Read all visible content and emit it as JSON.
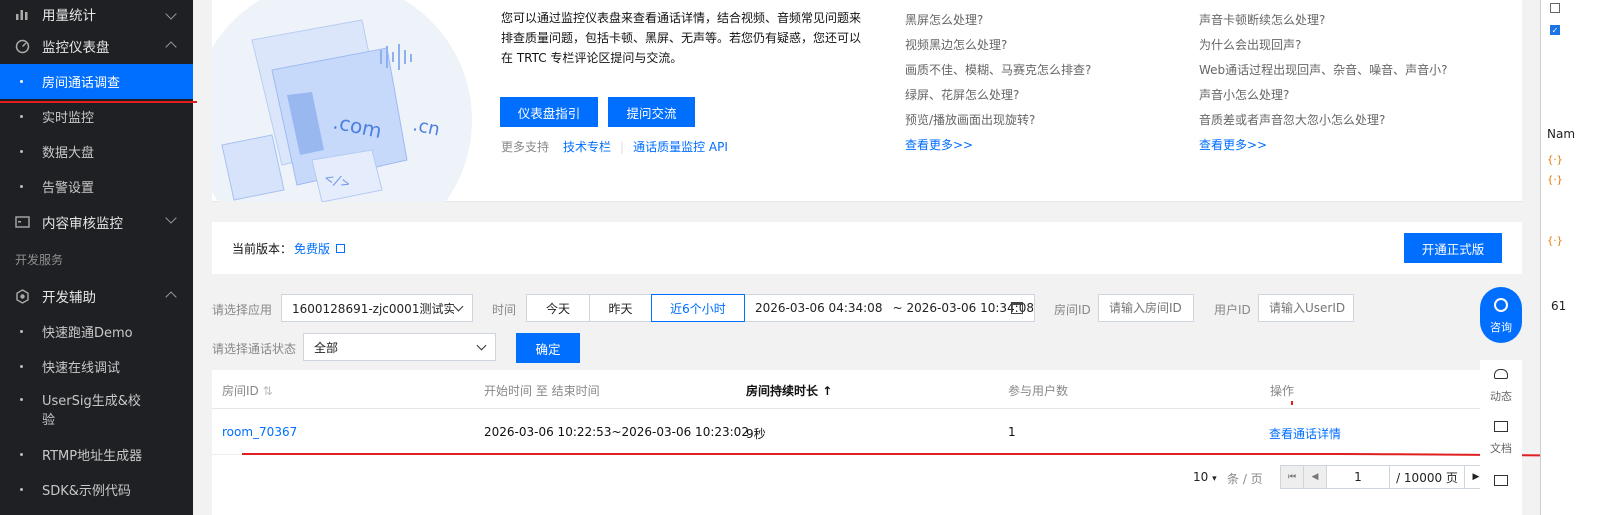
{
  "sidebar": {
    "groups": [
      {
        "label": "用量统计",
        "icon": "bar-chart-icon"
      },
      {
        "label": "监控仪表盘",
        "icon": "dashboard-icon"
      },
      {
        "label": "内容审核监控",
        "icon": "monitor-icon"
      },
      {
        "label": "开发辅助",
        "icon": "gear-icon"
      }
    ],
    "monitor_items": [
      "房间通话调查",
      "实时监控",
      "数据大盘",
      "告警设置"
    ],
    "section_label": "开发服务",
    "dev_items": [
      "快速跑通Demo",
      "快速在线调试",
      "UserSig生成&校验",
      "RTMP地址生成器",
      "SDK&示例代码"
    ]
  },
  "intro": {
    "text": "您可以通过监控仪表盘来查看通话详情，结合视频、音频常见问题来排查质量问题，包括卡顿、黑屏、无声等。若您仍有疑惑，您还可以在 TRTC 专栏评论区提问与交流。",
    "btn_guide": "仪表盘指引",
    "btn_ask": "提问交流",
    "more_support_label": "更多支持",
    "link_column": "技术专栏",
    "link_api": "通话质量监控 API"
  },
  "faq_video": {
    "items": [
      "黑屏怎么处理?",
      "视频黑边怎么处理?",
      "画质不佳、模糊、马赛克怎么排查?",
      "绿屏、花屏怎么处理?",
      "预览/播放画面出现旋转?"
    ],
    "more": "查看更多>>"
  },
  "faq_audio": {
    "items": [
      "声音卡顿断续怎么处理?",
      "为什么会出现回声?",
      "Web通话过程出现回声、杂音、噪音、声音小?",
      "声音小怎么处理?",
      "音质差或者声音忽大忽小怎么处理?"
    ],
    "more": "查看更多>>"
  },
  "version": {
    "label": "当前版本：",
    "value": "免费版",
    "upgrade_btn": "开通正式版"
  },
  "filters": {
    "app_label": "请选择应用",
    "app_value": "1600128691-zjc0001测试实时音",
    "time_label": "时间",
    "seg_today": "今天",
    "seg_yesterday": "昨天",
    "seg_6h": "近6个小时",
    "range_start": "2026-03-06 04:34:08",
    "range_sep": "~",
    "range_end": "2026-03-06 10:34:08",
    "room_label": "房间ID",
    "room_placeholder": "请输入房间ID",
    "user_label": "用户ID",
    "user_placeholder": "请输入UserID",
    "status_label": "请选择通话状态",
    "status_value": "全部",
    "confirm": "确定"
  },
  "table": {
    "headers": {
      "room_id": "房间ID",
      "time": "开始时间 至 结束时间",
      "duration": "房间持续时长",
      "users": "参与用户数",
      "action": "操作"
    },
    "rows": [
      {
        "room_id": "room_70367",
        "time": "2026-03-06 10:22:53~2026-03-06 10:23:02",
        "duration": "9秒",
        "users": "1",
        "action": "查看通话详情"
      }
    ]
  },
  "pager": {
    "page_size": "10",
    "per_page_label": "条 / 页",
    "current": "1",
    "total": "/ 10000 页"
  },
  "float_bar": {
    "consult": "咨询",
    "dynamic": "动态",
    "docs": "文档"
  },
  "devtools": {
    "name_header": "Nam",
    "count": "61"
  },
  "colors": {
    "primary": "#006eff",
    "sidebar_bg": "#1f2024",
    "annotation_red": "#e02020"
  }
}
